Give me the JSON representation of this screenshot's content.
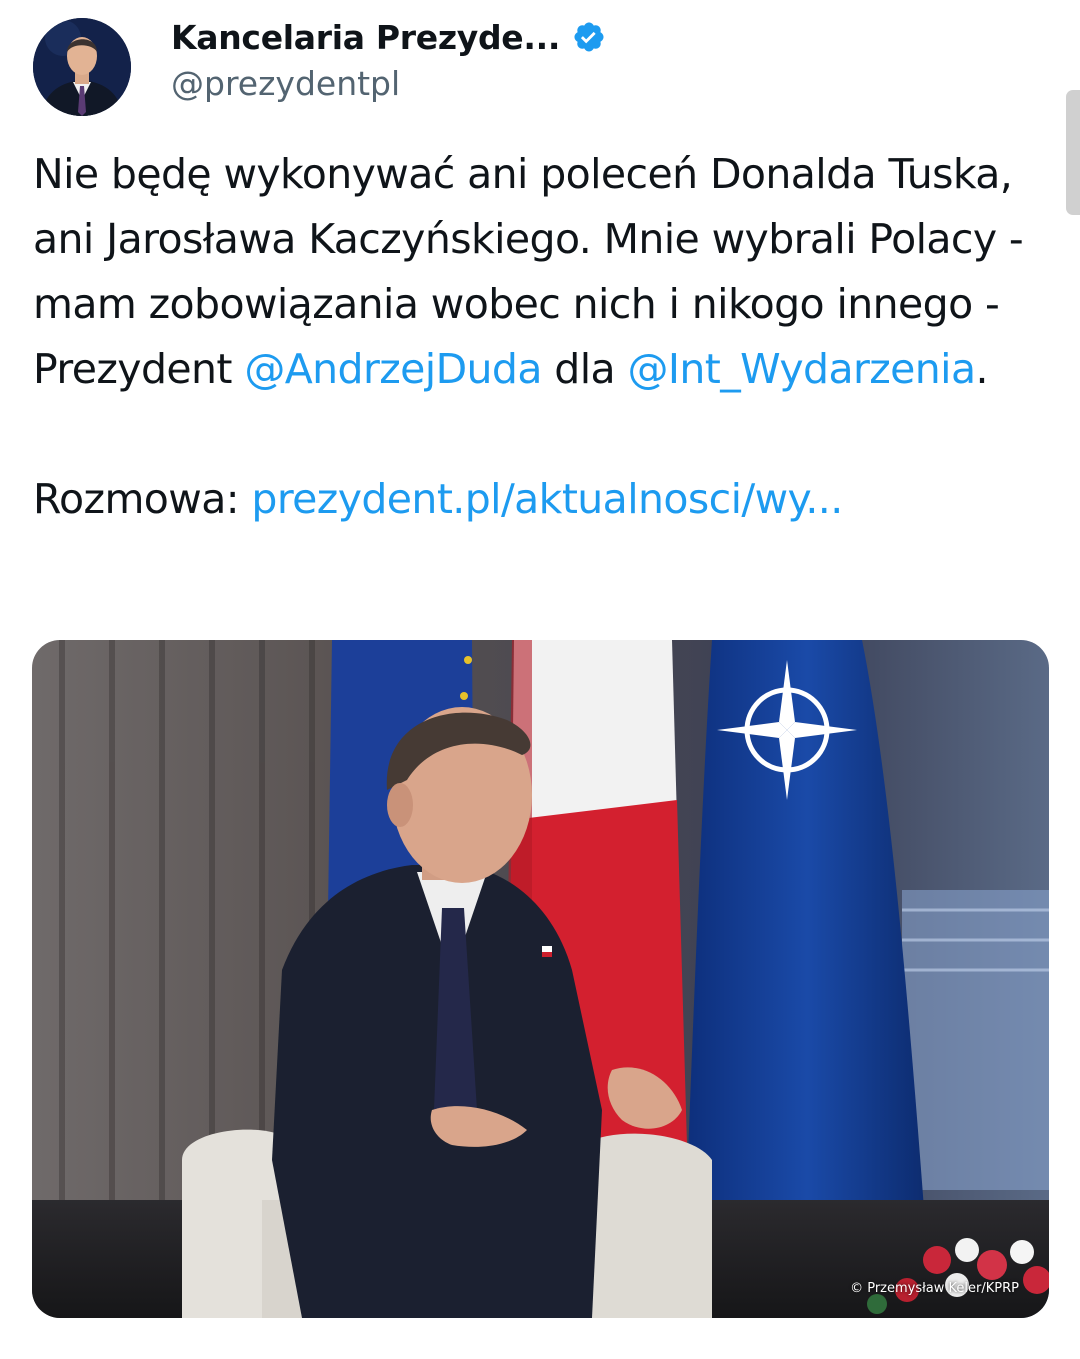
{
  "author": {
    "display_name": "Kancelaria Prezyde...",
    "handle": "@prezydentpl",
    "verified_icon": "verified-badge-icon",
    "verified_color": "#1d9bf0"
  },
  "tweet": {
    "text_part1": "Nie będę wykonywać ani poleceń Donalda Tuska, ani Jarosława Kaczyńskiego. Mnie wybrali Polacy - mam zobowiązania wobec nich i nikogo innego - Prezydent ",
    "mention1": "@AndrzejDuda",
    "text_part2": " dla ",
    "mention2": "@Int_Wydarzenia",
    "text_part3": ".",
    "link_prefix": "Rozmowa: ",
    "link_text": "prezydent.pl/aktualnosci/wy..."
  },
  "media": {
    "photo_credit": "© Przemysław Keler/KPRP"
  },
  "colors": {
    "link": "#1d9bf0",
    "text": "#0f1419",
    "secondary": "#536471"
  }
}
